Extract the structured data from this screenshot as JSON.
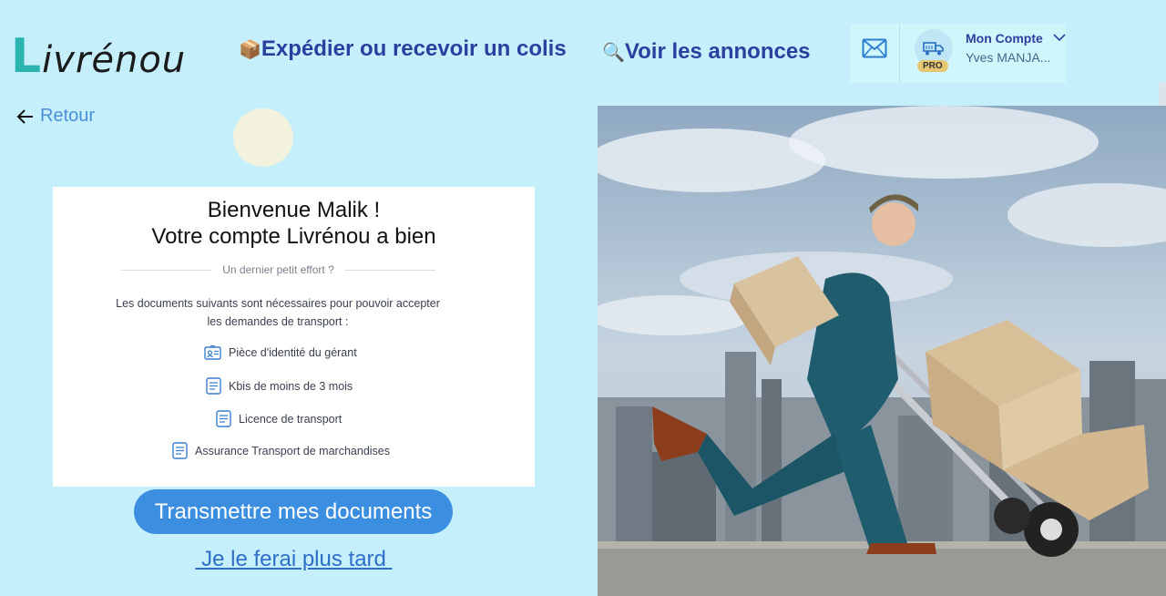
{
  "header": {
    "logo_first": "L",
    "logo_rest": "ivrénou",
    "nav_ship_emoji": "📦",
    "nav_ship_label": "Expédier ou recevoir un colis",
    "nav_ads_emoji": "🔍",
    "nav_ads_label": "Voir les annonces",
    "mail_icon": "mail-icon",
    "account_title": "Mon Compte",
    "account_name": "Yves MANJA...",
    "pro_badge": "PRO"
  },
  "back_link": "Retour",
  "card": {
    "title_line1": "Bienvenue Malik !",
    "title_line2": "Votre compte Livrénou a bien",
    "divider_text": "Un dernier petit effort ?",
    "description_line1": "Les documents suivants sont nécessaires pour pouvoir accepter",
    "description_line2": "les demandes de transport :",
    "documents": [
      {
        "label": "Pièce d'identité du gérant",
        "icon": "id-card-icon"
      },
      {
        "label": "Kbis de moins de 3 mois",
        "icon": "document-icon"
      },
      {
        "label": "Licence de transport",
        "icon": "document-icon"
      },
      {
        "label": "Assurance Transport de marchandises",
        "icon": "document-icon"
      }
    ]
  },
  "actions": {
    "submit_label": "Transmettre mes documents",
    "later_label": " Je le ferai plus tard "
  },
  "colors": {
    "background": "#c5effb",
    "brand_teal": "#2bb5b0",
    "nav_blue": "#2b3f9e",
    "primary_button": "#3b8ee0"
  }
}
